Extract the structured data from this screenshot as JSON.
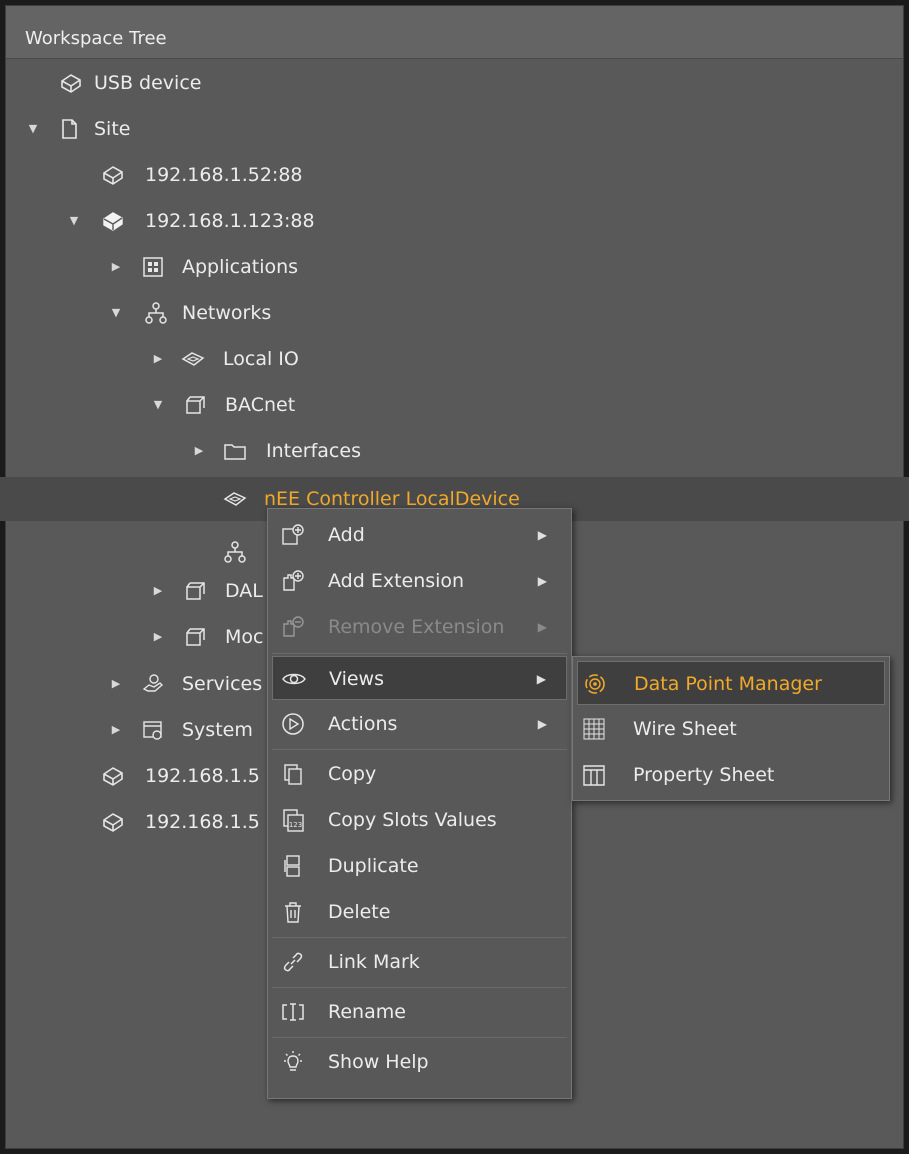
{
  "panel": {
    "title": "Workspace Tree"
  },
  "tree": {
    "usb_device": "USB device",
    "site": "Site",
    "dev_52": "192.168.1.52:88",
    "dev_123": "192.168.1.123:88",
    "applications": "Applications",
    "networks": "Networks",
    "local_io": "Local IO",
    "bacnet": "BACnet",
    "interfaces": "Interfaces",
    "local_device": "nEE Controller LocalDevice",
    "dali": "DAL",
    "modbus": "Moc",
    "services": "Services",
    "system": "System",
    "dev_5a": "192.168.1.5",
    "dev_5b": "192.168.1.5"
  },
  "context_menu": {
    "items": [
      {
        "label": "Add",
        "icon": "add-icon",
        "submenu": true
      },
      {
        "label": "Add Extension",
        "icon": "add-extension-icon",
        "submenu": true
      },
      {
        "label": "Remove Extension",
        "icon": "remove-extension-icon",
        "submenu": true,
        "disabled": true
      },
      {
        "label": "Views",
        "icon": "eye-icon",
        "submenu": true,
        "active": true
      },
      {
        "label": "Actions",
        "icon": "play-icon",
        "submenu": true
      },
      {
        "label": "Copy",
        "icon": "copy-icon"
      },
      {
        "label": "Copy Slots Values",
        "icon": "copy-values-icon"
      },
      {
        "label": "Duplicate",
        "icon": "duplicate-icon"
      },
      {
        "label": "Delete",
        "icon": "trash-icon"
      },
      {
        "label": "Link Mark",
        "icon": "link-icon"
      },
      {
        "label": "Rename",
        "icon": "rename-icon"
      },
      {
        "label": "Show Help",
        "icon": "lightbulb-icon"
      }
    ]
  },
  "views_submenu": {
    "items": [
      {
        "label": "Data Point Manager",
        "icon": "data-point-manager-icon",
        "active": true
      },
      {
        "label": "Wire Sheet",
        "icon": "wire-sheet-icon"
      },
      {
        "label": "Property Sheet",
        "icon": "property-sheet-icon"
      }
    ]
  },
  "colors": {
    "accent": "#f0a92b",
    "panel_bg": "#595959",
    "menu_bg": "#585858",
    "selected_row": "#4a4a4a"
  }
}
